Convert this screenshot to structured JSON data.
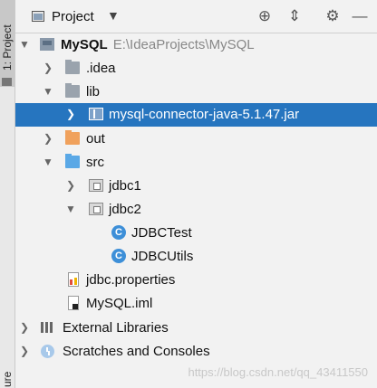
{
  "sidebar": {
    "tab_label": "1: Project",
    "bottom_label": "ure"
  },
  "header": {
    "title": "Project"
  },
  "tree": {
    "root": {
      "name": "MySQL",
      "path": "E:\\IdeaProjects\\MySQL"
    },
    "idea": ".idea",
    "lib": "lib",
    "jar": "mysql-connector-java-5.1.47.jar",
    "out": "out",
    "src": "src",
    "jdbc1": "jdbc1",
    "jdbc2": "jdbc2",
    "class1": "JDBCTest",
    "class2": "JDBCUtils",
    "properties": "jdbc.properties",
    "iml": "MySQL.iml",
    "external_libraries": "External Libraries",
    "scratches": "Scratches and Consoles"
  },
  "watermark": "https://blog.csdn.net/qq_43411550",
  "colors": {
    "selection": "#2675bf",
    "background": "#f2f2f2"
  }
}
